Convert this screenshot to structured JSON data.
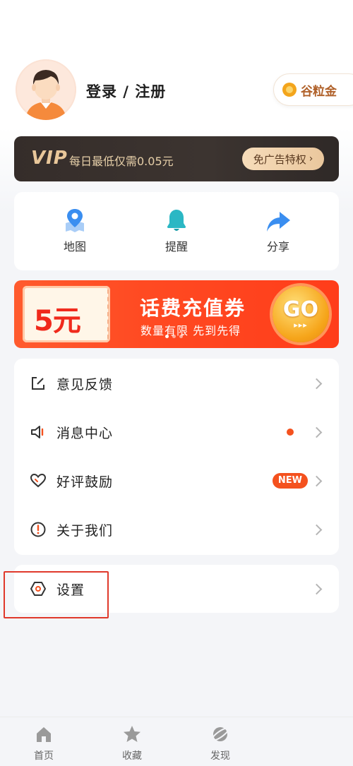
{
  "profile": {
    "login_text": "登录 / 注册",
    "coin_label": "谷粒金"
  },
  "vip": {
    "logo": "VIP",
    "desc": "每日最低仅需0.05元",
    "button": "免广告特权"
  },
  "quick_actions": [
    {
      "label": "地图",
      "icon": "map-pin-icon"
    },
    {
      "label": "提醒",
      "icon": "bell-icon"
    },
    {
      "label": "分享",
      "icon": "share-arrow-icon"
    }
  ],
  "banner": {
    "amount": "5元",
    "title": "话费充值券",
    "subtitle": "数量有限 先到先得",
    "go": "GO",
    "go_arrows": "▸▸▸",
    "active_dot": 0,
    "dot_count": 3
  },
  "menu": [
    {
      "label": "意见反馈",
      "icon": "edit-square-icon"
    },
    {
      "label": "消息中心",
      "icon": "speaker-icon",
      "indicator": "red-dot"
    },
    {
      "label": "好评鼓励",
      "icon": "heart-icon",
      "badge": "NEW"
    },
    {
      "label": "关于我们",
      "icon": "info-circle-icon"
    }
  ],
  "settings": {
    "label": "设置",
    "icon": "gear-icon"
  },
  "tabs": [
    {
      "label": "首页",
      "icon": "home-icon"
    },
    {
      "label": "收藏",
      "icon": "star-icon"
    },
    {
      "label": "发现",
      "icon": "planet-icon"
    }
  ],
  "colors": {
    "accent": "#f4511e",
    "vip_gold": "#e9c79a",
    "icon_blue": "#3a8ef0",
    "icon_teal": "#2bb7c4",
    "highlight": "#e0392b"
  }
}
